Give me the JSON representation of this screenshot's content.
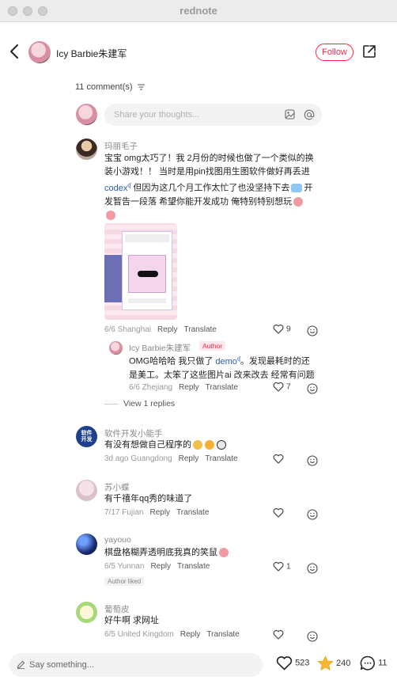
{
  "app_title": "rednote",
  "header": {
    "author_name": "Icy Barbie朱建军",
    "follow_label": "Follow"
  },
  "comments_count": "11 comment(s)",
  "input_placeholder": "Share your thoughts...",
  "comments": [
    {
      "name": "玛丽毛子",
      "text_lines": [
        "宝宝 omg太巧了！我 2月份的时候也做了一个类似的换",
        "装小游戏！！ 当时是用pin找图用生图软件做好再丢进",
        "codex",
        "但因为这几个月工作太忙了也没坚持下去",
        "开",
        "发暂告一段落 希望你能开发成功 俺特别特别想玩"
      ],
      "meta_date": "6/6 Shanghai",
      "reply": "Reply",
      "translate": "Translate",
      "likes": "9"
    },
    {
      "name": "Icy Barbie朱建军",
      "badge": "Author",
      "text_line1_pre": "OMG哈哈哈 我只做了",
      "text_link": "demo",
      "text_line1_post": "。发现最耗时的还",
      "text_line2": "是美工。太笨了这些图片ai 改来改去 经常有问题",
      "meta_date": "6/6 Zhejiang",
      "reply": "Reply",
      "translate": "Translate",
      "likes": "7"
    },
    {
      "name": "软件开发小能手",
      "text": "有没有想做自己程序的",
      "meta_date": "3d ago Guangdong",
      "reply": "Reply",
      "translate": "Translate"
    },
    {
      "name": "苏小蝶",
      "text": "有千禧年qq秀的味道了",
      "meta_date": "7/17 Fujian",
      "reply": "Reply",
      "translate": "Translate"
    },
    {
      "name": "yayouo",
      "text": "棋盘格糊弄透明底我真的笑鼠",
      "meta_date": "6/5 Yunnan",
      "reply": "Reply",
      "translate": "Translate",
      "likes": "1",
      "badge": "Author liked"
    },
    {
      "name": "葡萄皮",
      "text": "好牛啊 求网址",
      "meta_date": "6/5 United Kingdom",
      "reply": "Reply",
      "translate": "Translate"
    }
  ],
  "view_replies": "View 1 replies",
  "bottom": {
    "say_placeholder": "Say something...",
    "likes": "523",
    "stars": "240",
    "comments": "11"
  },
  "colors": {
    "accent": "#ff2442",
    "link": "#2e5dab",
    "star": "#f5b731"
  }
}
